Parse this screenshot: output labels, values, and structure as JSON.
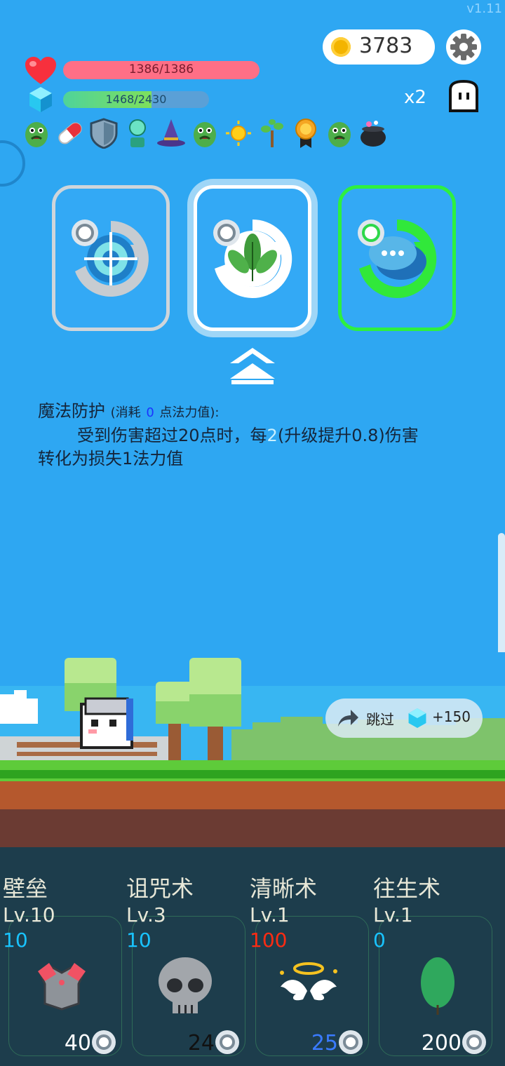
{
  "version": "v1.11",
  "coins": "3783",
  "hp": {
    "text": "1386/1386",
    "fraction": 1.0
  },
  "mp": {
    "text": "1468/2430",
    "fraction": 0.604
  },
  "speed": "x2",
  "icons": {
    "settings": "gear-icon",
    "pause": "ghost-icon",
    "heart": "heart-icon",
    "mana": "crystal-icon"
  },
  "buffs": [
    "green-monster",
    "capsule",
    "shield",
    "bust",
    "wizard-hat",
    "green-monster",
    "sun",
    "tree",
    "medal",
    "green-monster",
    "cauldron"
  ],
  "skill_choices": [
    {
      "icon": "target-icon",
      "border": "#cfd5da"
    },
    {
      "icon": "leaf-icon",
      "border": "#ffffff",
      "selected": true
    },
    {
      "icon": "speech-bubble-icon",
      "border": "#2ef03f"
    }
  ],
  "description": {
    "title": "魔法防护",
    "cost_prefix": "(消耗",
    "cost_value": "0",
    "cost_suffix": "点法力值):",
    "line1_a": "受到伤害超过20点时，每",
    "line1_b": "2",
    "line1_c": "(升级提升0.8)伤害",
    "line2": "转化为损失1法力值"
  },
  "skip": {
    "label": "跳过",
    "reward": "+150"
  },
  "slots": [
    {
      "name": "壁垒",
      "level": "Lv.10",
      "cost": "10",
      "cost_color": "#19c3ff",
      "count": "40",
      "count_color": "#ffffff",
      "icon": "armor-icon"
    },
    {
      "name": "诅咒术",
      "level": "Lv.3",
      "cost": "10",
      "cost_color": "#19c3ff",
      "count": "24",
      "count_color": "#111111",
      "icon": "skull-icon"
    },
    {
      "name": "清晰术",
      "level": "Lv.1",
      "cost": "100",
      "cost_color": "#ff2b12",
      "count": "25",
      "count_color": "#3a7bff",
      "icon": "halo-wings-icon"
    },
    {
      "name": "往生术",
      "level": "Lv.1",
      "cost": "0",
      "cost_color": "#19c3ff",
      "count": "200",
      "count_color": "#ffffff",
      "icon": "leaf-icon"
    }
  ]
}
